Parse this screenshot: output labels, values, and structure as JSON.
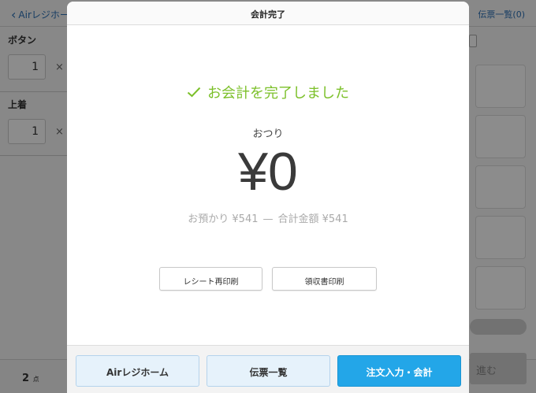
{
  "background": {
    "back_label": "Airレジホー",
    "right_link": "伝票一覧(0)",
    "items": [
      {
        "label": "ボタン",
        "qty": "1",
        "x": "×"
      },
      {
        "label": "上着",
        "qty": "1",
        "x": "×"
      }
    ],
    "count": "2",
    "count_unit": "点",
    "next_label": "進む"
  },
  "modal": {
    "title": "会計完了",
    "done_message": "お会計を完了しました",
    "change_label": "おつり",
    "change_amount": "¥0",
    "received": "お預かり ¥541",
    "dash": "—",
    "total": "合計金額 ¥541",
    "reprint_receipt": "レシート再印刷",
    "print_invoice": "領収書印刷",
    "footer": {
      "home": "Airレジホーム",
      "slips": "伝票一覧",
      "order": "注文入力・会計"
    }
  },
  "colors": {
    "success": "#7cc02a",
    "primary": "#23a6e8"
  }
}
